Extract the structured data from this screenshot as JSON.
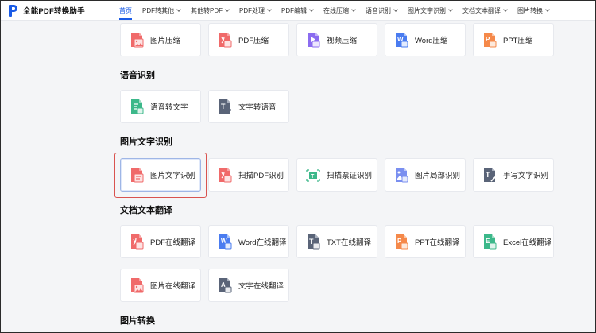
{
  "header": {
    "logo_text": "全能PDF转换助手",
    "nav": [
      {
        "label": "首页",
        "active": true,
        "dropdown": false
      },
      {
        "label": "PDF转其他",
        "active": false,
        "dropdown": true
      },
      {
        "label": "其他转PDF",
        "active": false,
        "dropdown": true
      },
      {
        "label": "PDF处理",
        "active": false,
        "dropdown": true
      },
      {
        "label": "PDF编辑",
        "active": false,
        "dropdown": true
      },
      {
        "label": "在线压缩",
        "active": false,
        "dropdown": true
      },
      {
        "label": "语音识别",
        "active": false,
        "dropdown": true
      },
      {
        "label": "图片文字识别",
        "active": false,
        "dropdown": true
      },
      {
        "label": "文档文本翻译",
        "active": false,
        "dropdown": true
      },
      {
        "label": "图片转换",
        "active": false,
        "dropdown": true
      }
    ]
  },
  "sections": {
    "compress": {
      "items": [
        {
          "label": "图片压缩",
          "icon": "image-icon",
          "color": "#f06a6a"
        },
        {
          "label": "PDF压缩",
          "icon": "pdf-icon",
          "color": "#f06a6a"
        },
        {
          "label": "视频压缩",
          "icon": "video-icon",
          "color": "#8b6cf0"
        },
        {
          "label": "Word压缩",
          "icon": "word-icon",
          "color": "#4a7cf0"
        },
        {
          "label": "PPT压缩",
          "icon": "ppt-icon",
          "color": "#f5894a"
        }
      ]
    },
    "speech": {
      "title": "语音识别",
      "items": [
        {
          "label": "语音转文字",
          "icon": "speech-to-text-icon",
          "color": "#3cb88a"
        },
        {
          "label": "文字转语音",
          "icon": "text-to-speech-icon",
          "color": "#5a6478"
        }
      ]
    },
    "ocr": {
      "title": "图片文字识别",
      "items": [
        {
          "label": "图片文字识别",
          "icon": "image-ocr-icon",
          "color": "#f06a6a",
          "selected": true
        },
        {
          "label": "扫描PDF识别",
          "icon": "scan-pdf-icon",
          "color": "#f06a6a"
        },
        {
          "label": "扫描票证识别",
          "icon": "scan-ticket-icon",
          "color": "#3cb88a"
        },
        {
          "label": "图片局部识别",
          "icon": "image-partial-icon",
          "color": "#7a8ff0"
        },
        {
          "label": "手写文字识别",
          "icon": "handwriting-icon",
          "color": "#5a6478"
        }
      ]
    },
    "translate": {
      "title": "文档文本翻译",
      "items": [
        {
          "label": "PDF在线翻译",
          "icon": "pdf-translate-icon",
          "color": "#f06a6a"
        },
        {
          "label": "Word在线翻译",
          "icon": "word-translate-icon",
          "color": "#4a7cf0"
        },
        {
          "label": "TXT在线翻译",
          "icon": "txt-translate-icon",
          "color": "#5a6478"
        },
        {
          "label": "PPT在线翻译",
          "icon": "ppt-translate-icon",
          "color": "#f5894a"
        },
        {
          "label": "Excel在线翻译",
          "icon": "excel-translate-icon",
          "color": "#3cb88a"
        },
        {
          "label": "图片在线翻译",
          "icon": "image-translate-icon",
          "color": "#f06a6a"
        },
        {
          "label": "文字在线翻译",
          "icon": "text-translate-icon",
          "color": "#5a6478"
        }
      ]
    },
    "image_convert": {
      "title": "图片转换"
    }
  },
  "colors": {
    "accent": "#1a5be6",
    "highlight_border": "#d9534f"
  }
}
